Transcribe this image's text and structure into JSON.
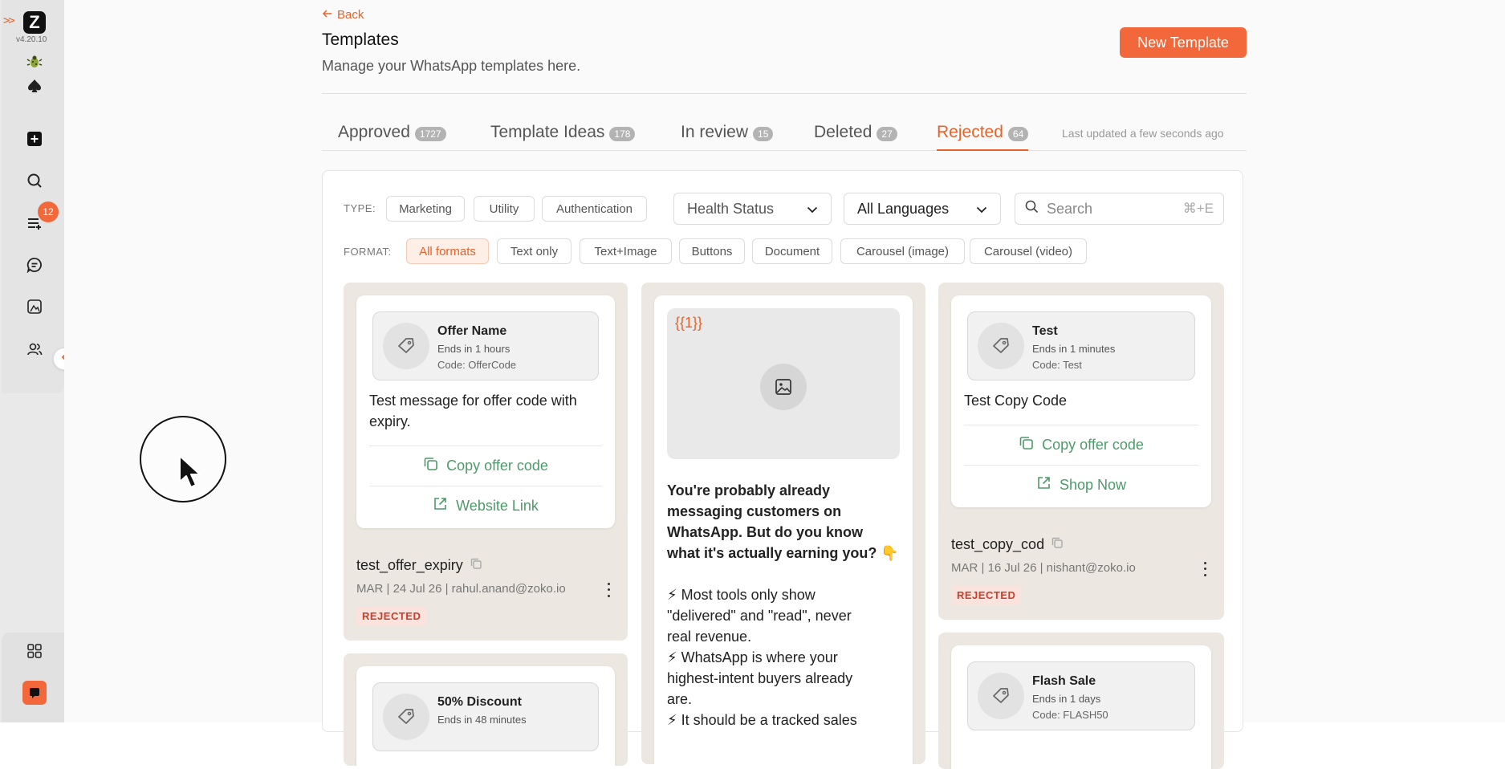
{
  "app": {
    "logo_letter": "Z",
    "version": "v4.20.10",
    "nav_badge": "12",
    "expand_glyph": ">>"
  },
  "header": {
    "back_label": "Back",
    "title": "Templates",
    "subtitle": "Manage your WhatsApp templates here.",
    "new_template_label": "New Template"
  },
  "tabs": [
    {
      "label": "Approved",
      "count": "1727"
    },
    {
      "label": "Template Ideas",
      "count": "178"
    },
    {
      "label": "In review",
      "count": "15"
    },
    {
      "label": "Deleted",
      "count": "27"
    },
    {
      "label": "Rejected",
      "count": "64"
    }
  ],
  "active_tab": "Rejected",
  "last_updated": "Last updated a few seconds ago",
  "filters": {
    "type_label": "TYPE:",
    "types": [
      "Marketing",
      "Utility",
      "Authentication"
    ],
    "format_label": "FORMAT:",
    "formats": [
      "All formats",
      "Text only",
      "Text+Image",
      "Buttons",
      "Document",
      "Carousel (image)",
      "Carousel (video)"
    ],
    "active_format": "All formats",
    "health_status": "Health Status",
    "language": "All Languages",
    "search_placeholder": "Search",
    "search_shortcut": "⌘+E"
  },
  "cards": [
    {
      "offer_name": "Offer Name",
      "offer_ends": "Ends in 1 hours",
      "offer_code": "Code: OfferCode",
      "body_line1": "Test message for offer code with",
      "body_line2": "expiry.",
      "button1": "Copy offer code",
      "button2": "Website Link",
      "name": "test_offer_expiry",
      "meta": "MAR | 24 Jul 26 | rahul.anand@zoko.io",
      "status": "REJECTED"
    },
    {
      "variable": "{{1}}",
      "lines": [
        "You're probably already",
        "messaging customers on",
        "WhatsApp. But do you know",
        "what it's actually earning you? 👇",
        "",
        "⚡ Most tools only show",
        "\"delivered\" and \"read\",  never",
        "real revenue.",
        "⚡ WhatsApp is where your",
        "highest-intent buyers already",
        "are.",
        "⚡ It should be a tracked sales"
      ]
    },
    {
      "offer_name": "Test",
      "offer_ends": "Ends in 1 minutes",
      "offer_code": "Code: Test",
      "body": "Test Copy Code",
      "button1": "Copy offer code",
      "button2": "Shop Now",
      "name": "test_copy_cod",
      "meta": "MAR | 16 Jul 26 | nishant@zoko.io",
      "status": "REJECTED"
    },
    {
      "offer_name": "50% Discount",
      "offer_ends": "Ends in 48 minutes"
    },
    {
      "offer_name": "Flash Sale",
      "offer_ends": "Ends in 1 days",
      "offer_code": "Code: FLASH50"
    }
  ],
  "colors": {
    "accent": "#f2683b",
    "button_text": "#4e9a6a",
    "status_bg": "#fbe3dd",
    "status_text": "#c8402c",
    "card_bg": "#ece8e1"
  },
  "icons": [
    "logo-icon",
    "bug-icon",
    "spade-icon",
    "plus-square-icon",
    "search-icon",
    "list-icon",
    "chat-icon",
    "image-icon",
    "users-icon",
    "chevron-left-icon",
    "grid-icon",
    "app-icon",
    "tag-icon",
    "copy-icon",
    "external-link-icon",
    "kebab-icon"
  ]
}
